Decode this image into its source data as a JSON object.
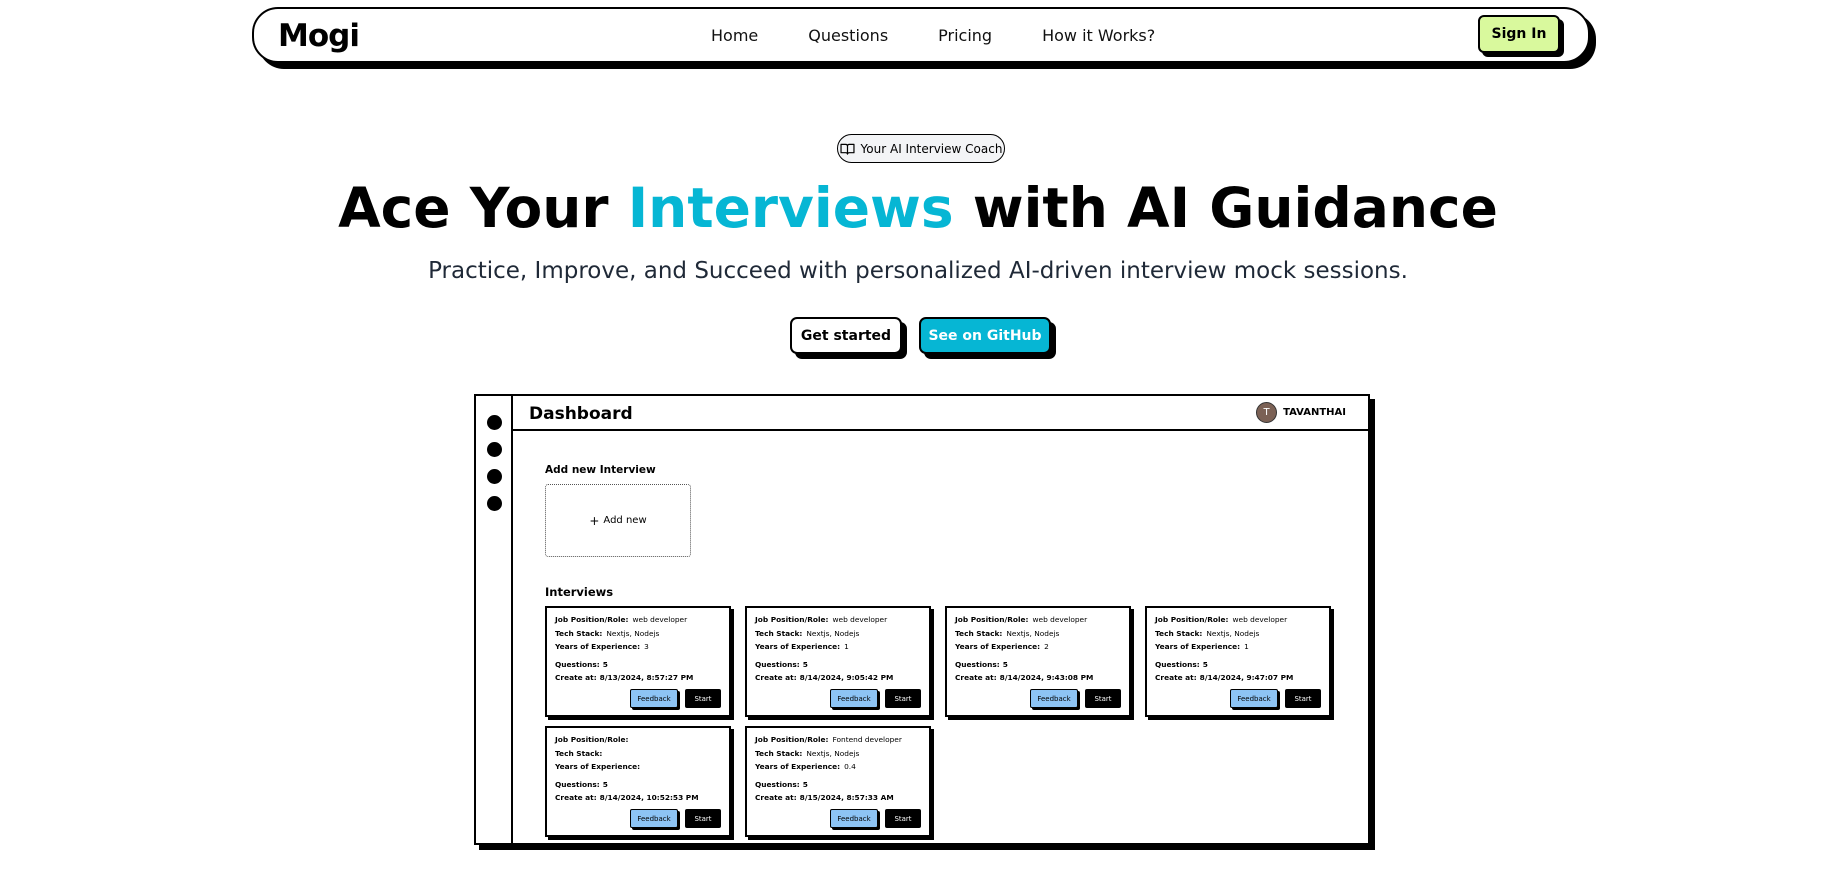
{
  "brand": "Mogi",
  "nav": {
    "links": [
      "Home",
      "Questions",
      "Pricing",
      "How it Works?"
    ],
    "signin": "Sign In"
  },
  "hero": {
    "badge": "Your AI Interview Coach",
    "title_pre": "Ace Your ",
    "title_accent": "Interviews",
    "title_post": " with AI Guidance",
    "subtitle": "Practice, Improve, and Succeed with personalized AI-driven interview mock sessions.",
    "btn_primary": "Get started",
    "btn_secondary": "See on GitHub"
  },
  "colors": {
    "accent": "#06b6d4",
    "signin_bg": "#d9f99d",
    "feedback_bg": "#8dc4f5"
  },
  "dashboard": {
    "title": "Dashboard",
    "user_initial": "T",
    "user_name": "TAVANTHAI",
    "add_label": "Add new Interview",
    "add_button": "Add new",
    "interviews_label": "Interviews",
    "labels": {
      "role": "Job Position/Role:",
      "stack": "Tech Stack:",
      "years": "Years of Experience:",
      "questions": "Questions:",
      "created": "Create at:"
    },
    "feedback_label": "Feedback",
    "start_label": "Start",
    "cards": [
      {
        "role": "web developer",
        "stack": "Nextjs, Nodejs",
        "years": "3",
        "questions": "5",
        "created": "8/13/2024, 8:57:27 PM"
      },
      {
        "role": "web developer",
        "stack": "Nextjs, Nodejs",
        "years": "1",
        "questions": "5",
        "created": "8/14/2024, 9:05:42 PM"
      },
      {
        "role": "web developer",
        "stack": "Nextjs, Nodejs",
        "years": "2",
        "questions": "5",
        "created": "8/14/2024, 9:43:08 PM"
      },
      {
        "role": "web developer",
        "stack": "Nextjs, Nodejs",
        "years": "1",
        "questions": "5",
        "created": "8/14/2024, 9:47:07 PM"
      },
      {
        "role": "",
        "stack": "",
        "years": "",
        "questions": "5",
        "created": "8/14/2024, 10:52:53 PM"
      },
      {
        "role": "Fontend developer",
        "stack": "Nextjs, Nodejs",
        "years": "0.4",
        "questions": "5",
        "created": "8/15/2024, 8:57:33 AM"
      }
    ]
  }
}
